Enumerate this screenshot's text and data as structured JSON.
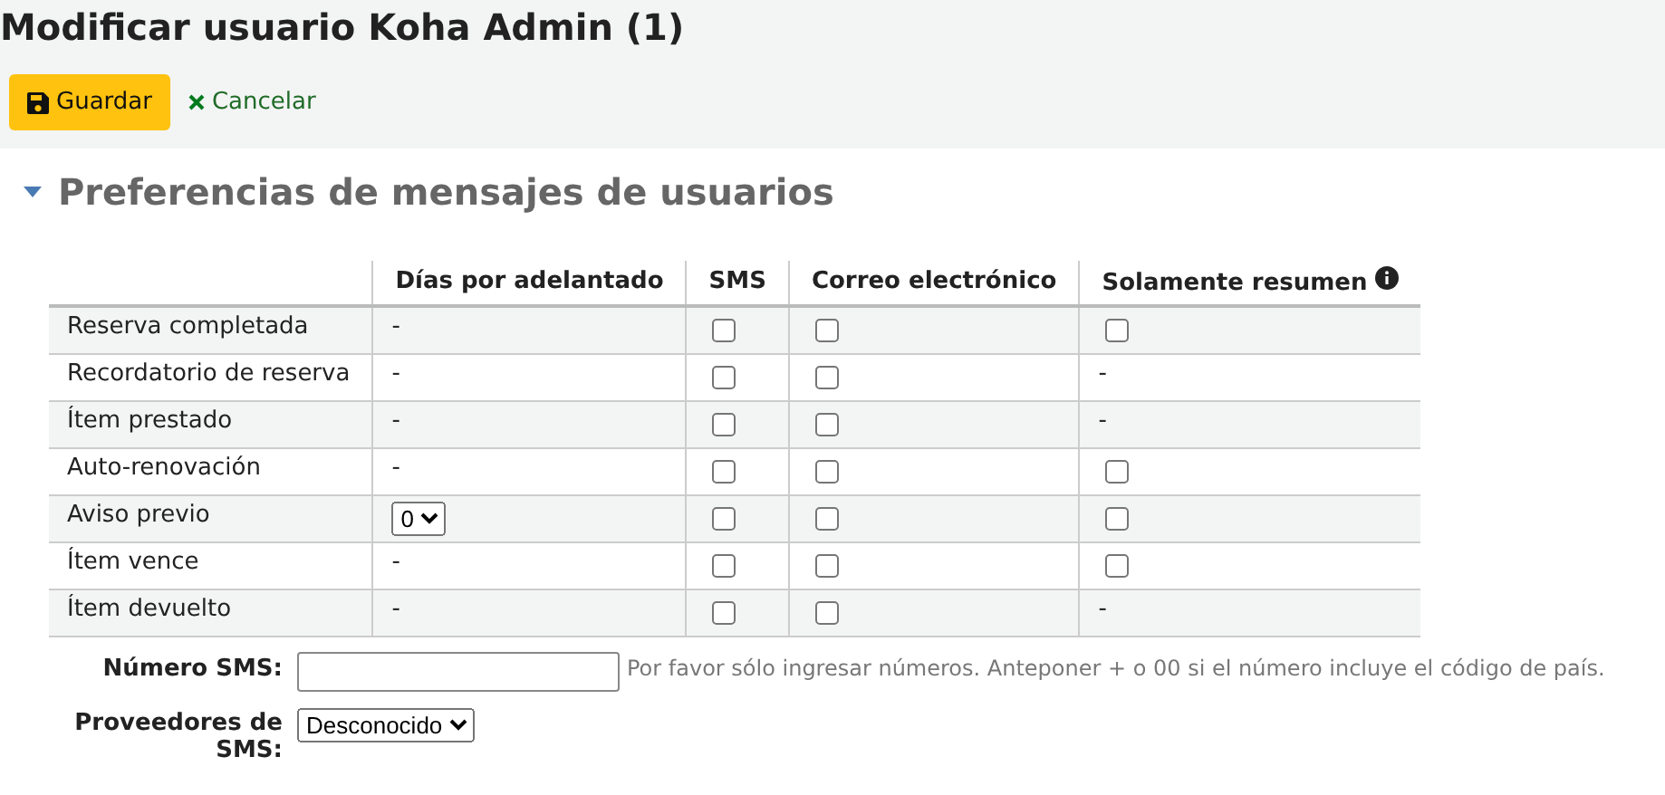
{
  "page_title": "Modificar usuario Koha Admin (1)",
  "toolbar": {
    "save_label": "Guardar",
    "cancel_label": "Cancelar"
  },
  "section": {
    "title": "Preferencias de mensajes de usuarios"
  },
  "table": {
    "columns": [
      "Días por adelantado",
      "SMS",
      "Correo electrónico",
      "Solamente resumen"
    ],
    "rows": [
      {
        "label": "Reserva completada",
        "days": {
          "kind": "text",
          "text": "-"
        },
        "sms": false,
        "email": false,
        "digest": {
          "kind": "checkbox",
          "checked": false
        }
      },
      {
        "label": "Recordatorio de reserva",
        "days": {
          "kind": "text",
          "text": "-"
        },
        "sms": false,
        "email": false,
        "digest": {
          "kind": "text",
          "text": "-"
        }
      },
      {
        "label": "Ítem prestado",
        "days": {
          "kind": "text",
          "text": "-"
        },
        "sms": false,
        "email": false,
        "digest": {
          "kind": "text",
          "text": "-"
        }
      },
      {
        "label": "Auto-renovación",
        "days": {
          "kind": "text",
          "text": "-"
        },
        "sms": false,
        "email": false,
        "digest": {
          "kind": "checkbox",
          "checked": false
        }
      },
      {
        "label": "Aviso previo",
        "days": {
          "kind": "select",
          "value": "0"
        },
        "sms": false,
        "email": false,
        "digest": {
          "kind": "checkbox",
          "checked": false
        }
      },
      {
        "label": "Ítem vence",
        "days": {
          "kind": "text",
          "text": "-"
        },
        "sms": false,
        "email": false,
        "digest": {
          "kind": "checkbox",
          "checked": false
        }
      },
      {
        "label": "Ítem devuelto",
        "days": {
          "kind": "text",
          "text": "-"
        },
        "sms": false,
        "email": false,
        "digest": {
          "kind": "text",
          "text": "-"
        }
      }
    ]
  },
  "sms_number": {
    "label": "Número SMS:",
    "hint": "Por favor sólo ingresar números. Anteponer + o 00 si el número incluye el código de país."
  },
  "sms_provider": {
    "label": "Proveedores de SMS:",
    "value": "Desconocido"
  }
}
